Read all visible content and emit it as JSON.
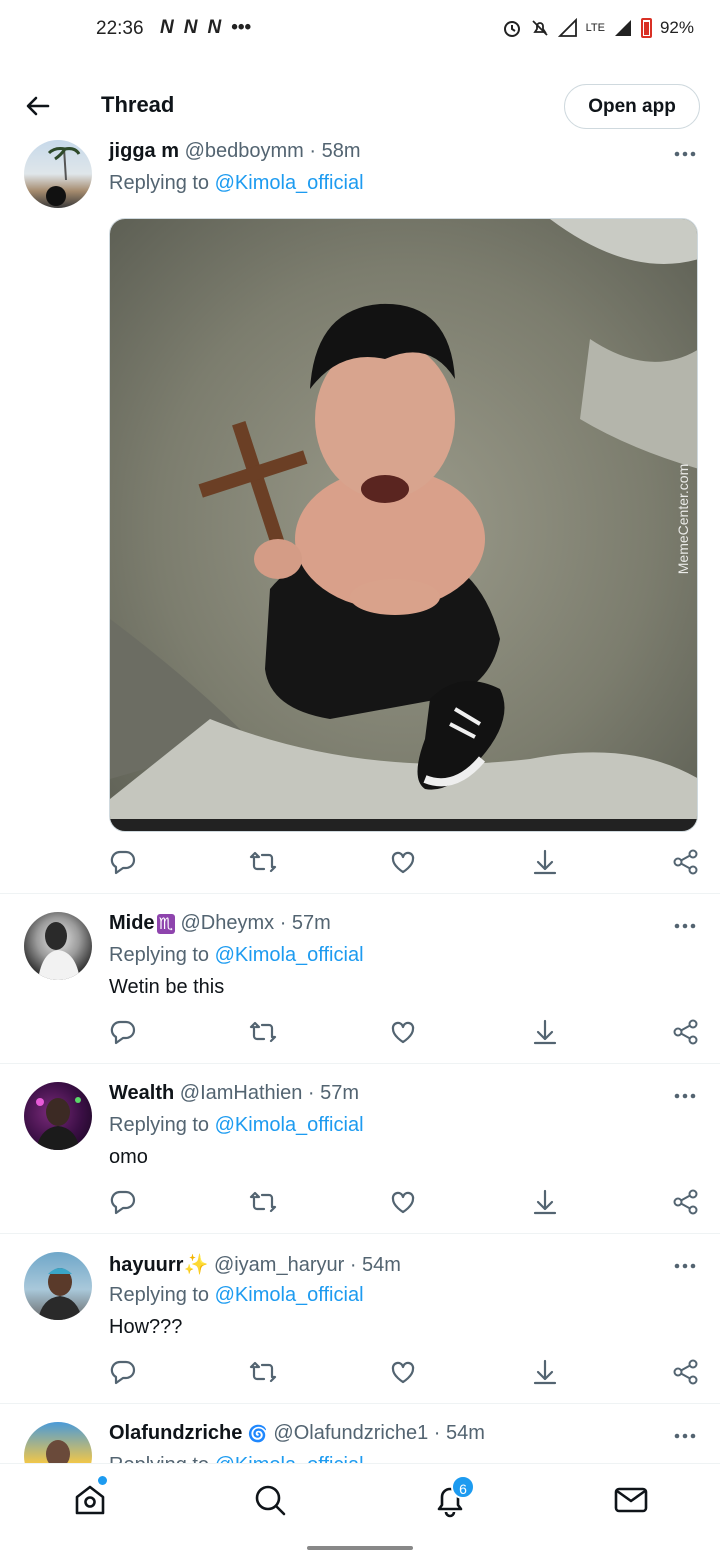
{
  "status_bar": {
    "time": "22:36",
    "left_icons": [
      "N",
      "N",
      "N",
      "•••"
    ],
    "network": "LTE",
    "battery": "92%"
  },
  "header": {
    "title": "Thread",
    "open_app": "Open app"
  },
  "tweets": [
    {
      "name": "jigga m",
      "handle": "@bedboymm",
      "time": "· 58m",
      "replying_prefix": "Replying to",
      "replying_to": "@Kimola_official",
      "text": "",
      "media_watermark": "MemeCenter.com"
    },
    {
      "name": "Mide",
      "name_emoji": "♏",
      "handle": "@Dheymx",
      "time": "· 57m",
      "replying_prefix": "Replying to",
      "replying_to": "@Kimola_official",
      "text": "Wetin be this"
    },
    {
      "name": "Wealth",
      "handle": "@IamHathien",
      "time": "· 57m",
      "replying_prefix": "Replying to",
      "replying_to": "@Kimola_official",
      "text": "omo"
    },
    {
      "name": "hayuurr",
      "name_emoji": "✨",
      "handle": "@iyam_haryur",
      "time": "· 54m",
      "replying_prefix": "Replying to",
      "replying_to": "@Kimola_official",
      "text": "How???"
    },
    {
      "name": "Olafundzriche",
      "name_emoji": "🌀",
      "handle": "@Olafundzriche1",
      "time": "· 54m",
      "replying_prefix": "Replying to",
      "replying_to": "@Kimola_official",
      "text": ""
    }
  ],
  "bottom_nav": {
    "items": [
      "home-icon",
      "search-icon",
      "notifications-icon",
      "messages-icon"
    ],
    "notification_count": "6"
  },
  "colors": {
    "accent": "#1d9bf0",
    "text": "#0f1419",
    "muted": "#536471"
  }
}
